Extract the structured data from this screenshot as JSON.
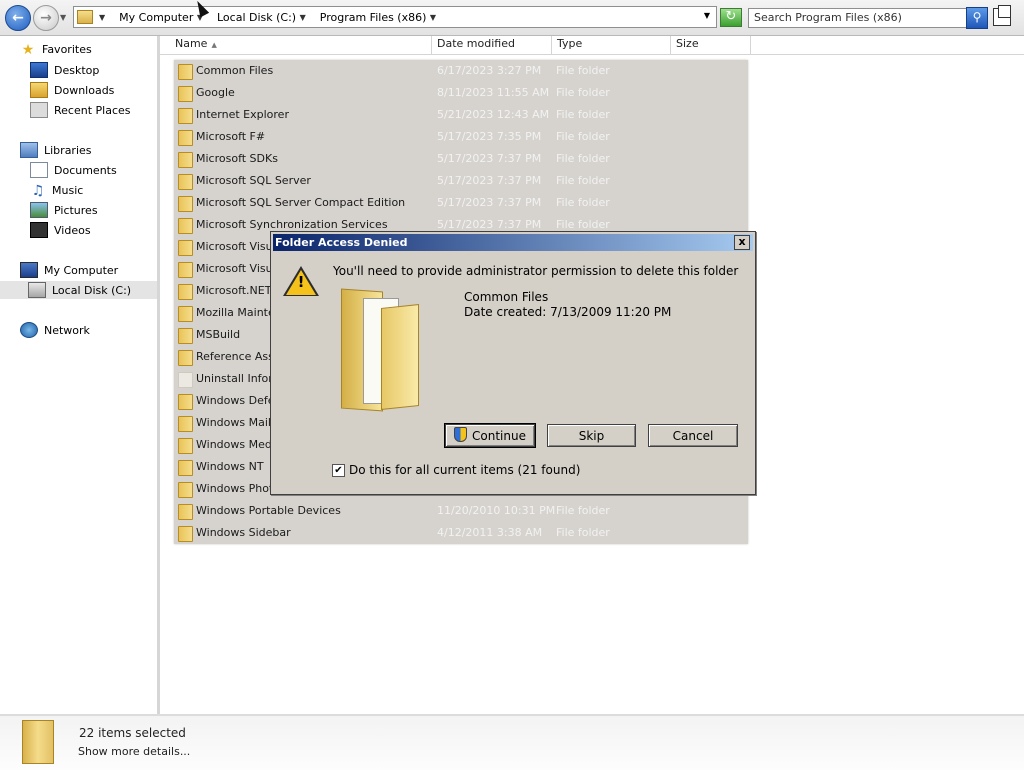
{
  "address": {
    "crumbs": [
      "My Computer",
      "Local Disk (C:)",
      "Program Files (x86)"
    ],
    "search_placeholder": "Search Program Files (x86)"
  },
  "nav": {
    "favorites": "Favorites",
    "desktop": "Desktop",
    "downloads": "Downloads",
    "recent": "Recent Places",
    "libraries": "Libraries",
    "documents": "Documents",
    "music": "Music",
    "pictures": "Pictures",
    "videos": "Videos",
    "computer": "My Computer",
    "localdisk": "Local Disk (C:)",
    "network": "Network"
  },
  "columns": {
    "name": "Name",
    "date": "Date modified",
    "type": "Type",
    "size": "Size"
  },
  "rows": [
    {
      "name": "Common Files",
      "date": "6/17/2023 3:27 PM",
      "type": "File folder"
    },
    {
      "name": "Google",
      "date": "8/11/2023 11:55 AM",
      "type": "File folder"
    },
    {
      "name": "Internet Explorer",
      "date": "5/21/2023 12:43 AM",
      "type": "File folder"
    },
    {
      "name": "Microsoft F#",
      "date": "5/17/2023 7:35 PM",
      "type": "File folder"
    },
    {
      "name": "Microsoft SDKs",
      "date": "5/17/2023 7:37 PM",
      "type": "File folder"
    },
    {
      "name": "Microsoft SQL Server",
      "date": "5/17/2023 7:37 PM",
      "type": "File folder"
    },
    {
      "name": "Microsoft SQL Server Compact Edition",
      "date": "5/17/2023 7:37 PM",
      "type": "File folder"
    },
    {
      "name": "Microsoft Synchronization Services",
      "date": "5/17/2023 7:37 PM",
      "type": "File folder"
    },
    {
      "name": "Microsoft Visua",
      "date": "",
      "type": ""
    },
    {
      "name": "Microsoft Visua",
      "date": "",
      "type": ""
    },
    {
      "name": "Microsoft.NET",
      "date": "",
      "type": ""
    },
    {
      "name": "Mozilla Mainten",
      "date": "",
      "type": ""
    },
    {
      "name": "MSBuild",
      "date": "",
      "type": ""
    },
    {
      "name": "Reference Asse",
      "date": "",
      "type": ""
    },
    {
      "name": "Uninstall Inforn",
      "date": "",
      "type": ""
    },
    {
      "name": "Windows Defer",
      "date": "",
      "type": ""
    },
    {
      "name": "Windows Mail",
      "date": "",
      "type": ""
    },
    {
      "name": "Windows Media",
      "date": "",
      "type": ""
    },
    {
      "name": "Windows NT",
      "date": "",
      "type": ""
    },
    {
      "name": "Windows Photo",
      "date": "",
      "type": ""
    },
    {
      "name": "Windows Portable Devices",
      "date": "11/20/2010 10:31 PM",
      "type": "File folder"
    },
    {
      "name": "Windows Sidebar",
      "date": "4/12/2011 3:38 AM",
      "type": "File folder"
    }
  ],
  "status": {
    "selected": "22 items selected",
    "details": "Show more details..."
  },
  "dialog": {
    "title": "Folder Access Denied",
    "close": "x",
    "message": "You'll need to provide administrator permission to delete this folder",
    "folder_name": "Common Files",
    "date_created": "Date created: 7/13/2009 11:20 PM",
    "continue": "Continue",
    "skip": "Skip",
    "cancel": "Cancel",
    "checkbox_label": "Do this for all current items (21 found)",
    "checkbox_checked": true
  }
}
